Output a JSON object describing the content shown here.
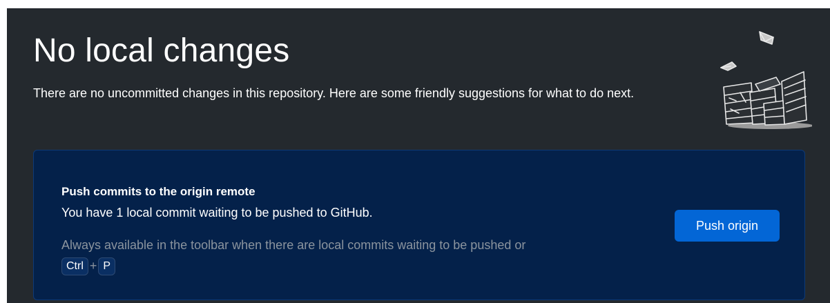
{
  "header": {
    "title": "No local changes",
    "subtitle": "There are no uncommitted changes in this repository. Here are some friendly suggestions for what to do next."
  },
  "illustration": {
    "icon": "paper-stacks-illustration"
  },
  "suggestion_card": {
    "title": "Push commits to the origin remote",
    "description": "You have 1 local commit waiting to be pushed to GitHub.",
    "hint": "Always available in the toolbar when there are local commits waiting to be pushed or",
    "shortcut": {
      "key1": "Ctrl",
      "separator": "+",
      "key2": "P"
    },
    "button_label": "Push origin"
  },
  "colors": {
    "background": "#24292e",
    "card_background": "#04214a",
    "card_border": "#0d3a78",
    "button": "#0366d6",
    "muted_text": "#8b949e"
  }
}
